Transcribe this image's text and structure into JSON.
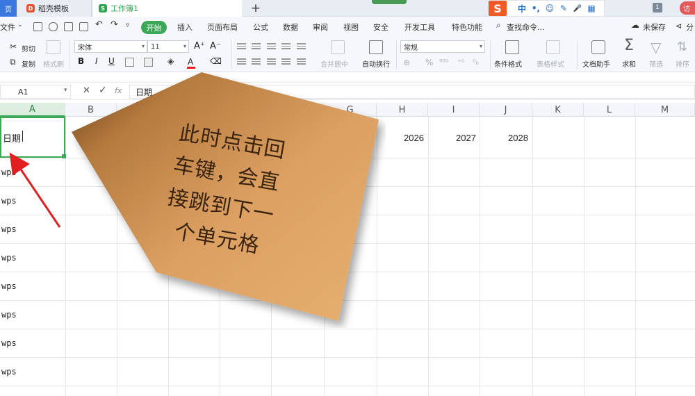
{
  "titlebar": {
    "tabs": [
      {
        "label": "稻壳模板"
      },
      {
        "label": "工作簿1"
      }
    ],
    "new_tab": "+",
    "ime": {
      "logo": "S",
      "items": [
        "中",
        "•,",
        "☺",
        "✎",
        "🎤",
        "▦"
      ]
    },
    "window_badge": "1",
    "visitor": "访"
  },
  "menu": {
    "file": "文件",
    "start": "开始",
    "items": [
      "插入",
      "页面布局",
      "公式",
      "数据",
      "审阅",
      "视图",
      "安全",
      "开发工具",
      "特色功能"
    ],
    "search": "查找命令...",
    "unsaved": "未保存",
    "share": "分"
  },
  "ribbon": {
    "cut": "剪切",
    "copy": "复制",
    "format_painter": "格式刷",
    "font_name": "宋体",
    "font_size": "11",
    "grow": "A⁺",
    "shrink": "A⁻",
    "bold": "B",
    "italic": "I",
    "underline": "U",
    "merge": "合并居中",
    "wrap": "自动换行",
    "number_format": "常规",
    "percent": "%",
    "conditional": "条件格式",
    "table_style": "表格样式",
    "doc_helper": "文档助手",
    "sum": "求和",
    "filter": "筛选",
    "sort": "排序"
  },
  "formula_bar": {
    "name_box": "A1",
    "cancel": "✕",
    "confirm": "✓",
    "fx": "fx",
    "value": "日期"
  },
  "columns": [
    "A",
    "B",
    "C",
    "D",
    "E",
    "F",
    "G",
    "H",
    "I",
    "J",
    "K",
    "L",
    "M"
  ],
  "cells": {
    "a1": "日期",
    "a_rows": [
      "wps",
      "wps",
      "wps",
      "wps",
      "wps",
      "wps",
      "wps",
      "wps"
    ],
    "h1": "2026",
    "i1": "2027",
    "j1": "2028"
  },
  "callout": {
    "lines": [
      "此时点击回",
      "车键，会直",
      "接跳到下一",
      "个单元格"
    ],
    "color": "#c98a45"
  },
  "arrow_color": "#e02020",
  "accent": "#3aa857"
}
